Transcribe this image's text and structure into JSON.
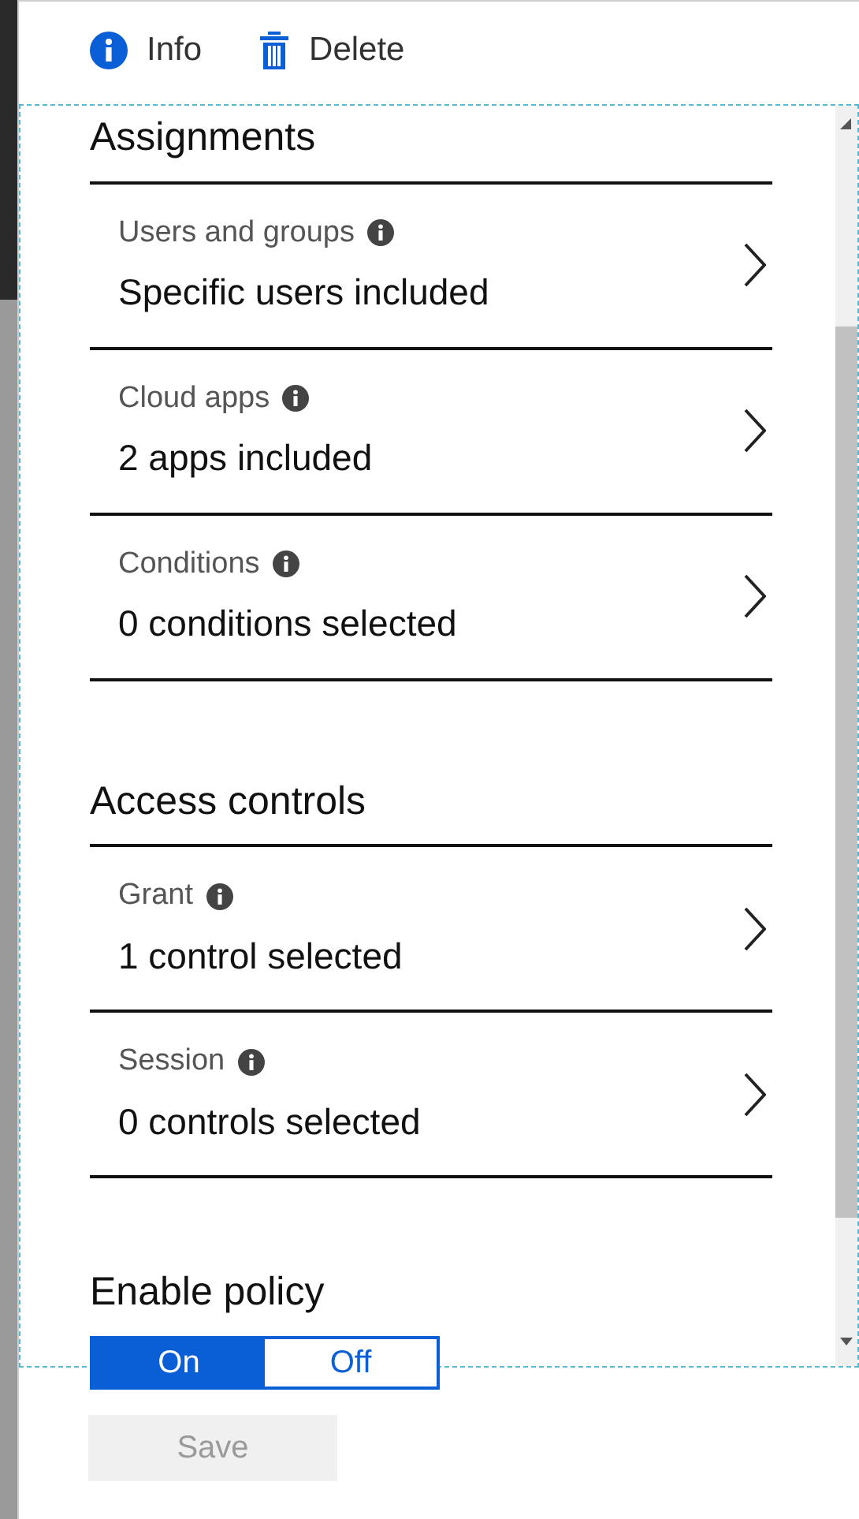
{
  "toolbar": [
    {
      "kind": "info",
      "label": "Info"
    },
    {
      "kind": "delete",
      "label": "Delete"
    }
  ],
  "sections": [
    {
      "title": "Assignments",
      "items": [
        {
          "label": "Users and groups",
          "value": "Specific users included"
        },
        {
          "label": "Cloud apps",
          "value": "2 apps included"
        },
        {
          "label": "Conditions",
          "value": "0 conditions selected"
        }
      ]
    },
    {
      "title": "Access controls",
      "items": [
        {
          "label": "Grant",
          "value": "1 control selected"
        },
        {
          "label": "Session",
          "value": "0 controls selected"
        }
      ]
    }
  ],
  "enable_policy": {
    "title": "Enable policy",
    "options": [
      {
        "label": "On",
        "selected": true
      },
      {
        "label": "Off",
        "selected": false
      }
    ]
  },
  "save": {
    "label": "Save",
    "disabled": true
  }
}
